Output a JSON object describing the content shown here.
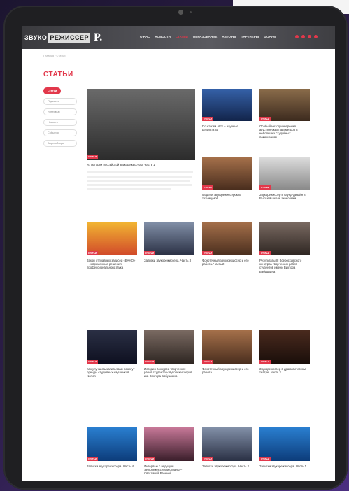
{
  "site": {
    "logo_text": "ЗВУКО",
    "logo_highlight": "РЕЖИССЕР",
    "publisher_logo": "P."
  },
  "nav": [
    "О НАС",
    "НОВОСТИ",
    "СТАТЬИ",
    "ОБРАЗОВАНИЕ",
    "АВТОРЫ",
    "ПАРТНЕРЫ",
    "ФОРУМ"
  ],
  "breadcrumb": "Главная / Статьи",
  "page_title": "СТАТЬИ",
  "sidebar": [
    "Статьи",
    "Подкасты",
    "Интервью",
    "Новости",
    "События",
    "Бюро-обзоры"
  ],
  "tag_label": "СТАТЬИ",
  "articles": [
    {
      "title": "Из истории российской звукорежиссуры. Часть 1"
    },
    {
      "title": "По итогам AES – научные результаты"
    },
    {
      "title": "Особый метод измерения акустических параметров в небольших студийных помещениях"
    },
    {
      "title": "Модели звукорежиссерских техникумов"
    },
    {
      "title": "Звукорежиссер и саунд-дизайн в Высшей школе экономики"
    },
    {
      "title": "Закон отправных записей «ВАНО» – современные решения профессионального звука"
    },
    {
      "title": "Записки звукорежиссера. Часть 3"
    },
    {
      "title": "Фонотечный звукорежиссер и его работа. Часть 2"
    },
    {
      "title": "Результаты III Всероссийского конкурса творческих работ студентов имени Виктора Бабушкина"
    },
    {
      "title": "Как улучшить запись: вам помогут бренды студийных наушников Norton"
    },
    {
      "title": "История Конкурса творческих работ студентов-звукорежиссеров им. Виктора Бабушкина"
    },
    {
      "title": "Фонотечный звукорежиссер и его работа"
    },
    {
      "title": "Звукорежиссер в драматическом театре. Часть 2"
    },
    {
      "title": "Записки звукорежиссера. Часть 4"
    },
    {
      "title": "Интервью с ведущим звукорежиссером страны – Светланой Разиной"
    },
    {
      "title": "Записки звукорежиссера. Часть 2"
    },
    {
      "title": "Записки звукорежиссера. Часть 1"
    }
  ]
}
